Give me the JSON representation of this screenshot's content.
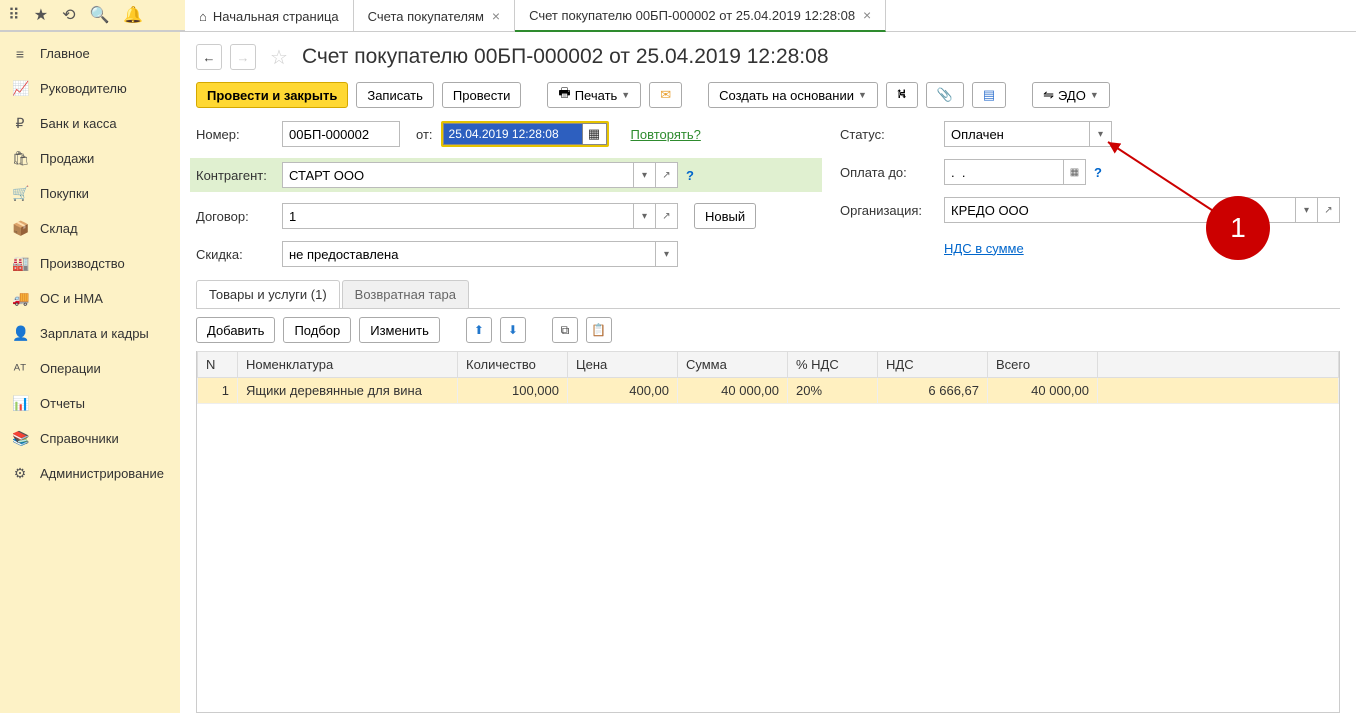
{
  "topIcons": [
    "⋮⋮⋮",
    "★",
    "⟲",
    "🔍",
    "🔔"
  ],
  "tabs": [
    {
      "label": "Начальная страница",
      "home": true,
      "close": false
    },
    {
      "label": "Счета покупателям",
      "close": true
    },
    {
      "label": "Счет покупателю 00БП-000002 от 25.04.2019 12:28:08",
      "close": true,
      "active": true
    }
  ],
  "sidebar": [
    {
      "ico": "≡",
      "label": "Главное"
    },
    {
      "ico": "📈",
      "label": "Руководителю"
    },
    {
      "ico": "₽",
      "label": "Банк и касса"
    },
    {
      "ico": "🛍",
      "label": "Продажи"
    },
    {
      "ico": "🛒",
      "label": "Покупки"
    },
    {
      "ico": "📦",
      "label": "Склад"
    },
    {
      "ico": "🏭",
      "label": "Производство"
    },
    {
      "ico": "🚚",
      "label": "ОС и НМА"
    },
    {
      "ico": "👤",
      "label": "Зарплата и кадры"
    },
    {
      "ico": "ᴬᵀ",
      "label": "Операции"
    },
    {
      "ico": "📊",
      "label": "Отчеты"
    },
    {
      "ico": "📚",
      "label": "Справочники"
    },
    {
      "ico": "⚙",
      "label": "Администрирование"
    }
  ],
  "title": "Счет покупателю 00БП-000002 от 25.04.2019 12:28:08",
  "toolbar": {
    "post_close": "Провести и закрыть",
    "save": "Записать",
    "post": "Провести",
    "print": "Печать",
    "create_based": "Создать на основании",
    "edo": "ЭДО"
  },
  "fields": {
    "number_lbl": "Номер:",
    "number": "00БП-000002",
    "from_lbl": "от:",
    "date": "25.04.2019 12:28:08",
    "repeat": "Повторять?",
    "contractor_lbl": "Контрагент:",
    "contractor": "СТАРТ ООО",
    "contract_lbl": "Договор:",
    "contract": "1",
    "contract_new": "Новый",
    "discount_lbl": "Скидка:",
    "discount": "не предоставлена",
    "status_lbl": "Статус:",
    "status": "Оплачен",
    "payuntil_lbl": "Оплата до:",
    "payuntil": ".  .",
    "org_lbl": "Организация:",
    "org": "КРЕДО ООО",
    "vat_link": "НДС в сумме",
    "help": "?"
  },
  "doc_tabs": {
    "goods": "Товары и услуги (1)",
    "tare": "Возвратная тара"
  },
  "tbl_toolbar": {
    "add": "Добавить",
    "pick": "Подбор",
    "edit": "Изменить"
  },
  "columns": [
    "N",
    "Номенклатура",
    "Количество",
    "Цена",
    "Сумма",
    "% НДС",
    "НДС",
    "Всего"
  ],
  "rows": [
    {
      "n": "1",
      "nom": "Ящики деревянные для вина",
      "qty": "100,000",
      "price": "400,00",
      "sum": "40 000,00",
      "vat_pct": "20%",
      "vat": "6 666,67",
      "total": "40 000,00"
    }
  ],
  "annotation": "1"
}
